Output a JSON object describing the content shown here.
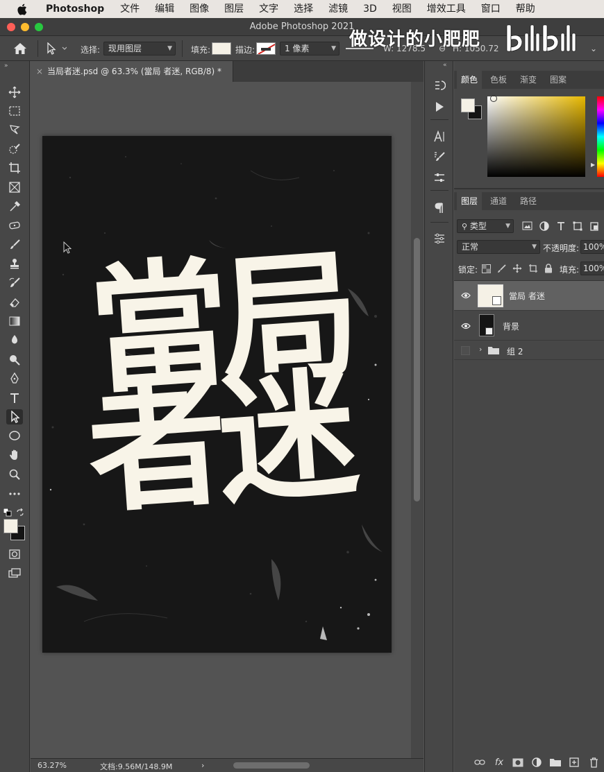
{
  "menubar": {
    "app": "Photoshop",
    "items": [
      "文件",
      "编辑",
      "图像",
      "图层",
      "文字",
      "选择",
      "滤镜",
      "3D",
      "视图",
      "增效工具",
      "窗口",
      "帮助"
    ]
  },
  "window": {
    "title": "Adobe Photoshop 2021"
  },
  "watermark": {
    "text": "做设计的小肥肥",
    "logo": "bilibili"
  },
  "options": {
    "select_label": "选择:",
    "select_value": "现用图层",
    "fill_label": "填充:",
    "stroke_label": "描边:",
    "stroke_size": "1 像素",
    "w_value": "W: 1278.5",
    "h_value": "H: 1050.72"
  },
  "document_tab": {
    "label": "当局者迷.psd @ 63.3% (當局 者迷, RGB/8) *"
  },
  "artwork": {
    "line1": "當局",
    "line2": "者迷"
  },
  "status": {
    "zoom": "63.27%",
    "doc_info": "文档:9.56M/148.9M"
  },
  "color_panel": {
    "tabs": [
      "颜色",
      "色板",
      "渐变",
      "图案"
    ],
    "active": "颜色"
  },
  "layers_panel": {
    "tabs": [
      "图层",
      "通道",
      "路径"
    ],
    "filter_label": "类型",
    "blend_mode": "正常",
    "opacity_label": "不透明度:",
    "opacity_value": "100%",
    "lock_label": "锁定:",
    "fill_label": "填充:",
    "fill_value": "100%",
    "layers": [
      {
        "name": "當局 者迷",
        "visible": true,
        "selected": true
      },
      {
        "name": "背景",
        "visible": true,
        "selected": false
      },
      {
        "name": "组 2",
        "visible": false,
        "selected": false
      }
    ]
  },
  "colors": {
    "foreground": "#f5f1e6",
    "background": "#141414",
    "accent_text": "#f8f4e8"
  }
}
